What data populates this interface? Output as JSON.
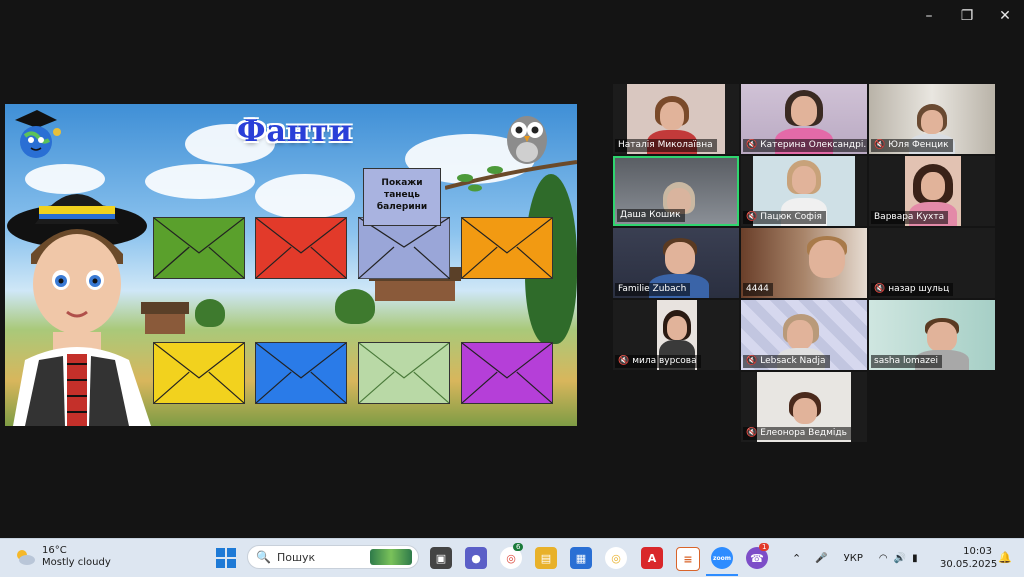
{
  "window": {
    "minimize_icon": "minimize-icon",
    "restore_icon": "restore-icon",
    "close_icon": "close-icon"
  },
  "slide": {
    "title": "Фанти",
    "card_text": "Покажи танець балерини",
    "envelope_colors": [
      "#5aa02c",
      "#e23a2a",
      "#9aa6d8",
      "#f29a12",
      "#f2d21e",
      "#2a7be8",
      "#b9d9a6",
      "#b53fd8"
    ]
  },
  "participants": [
    {
      "name": "Наталія Миколаївна",
      "muted": false
    },
    {
      "name": "Катерина Олександрі...",
      "muted": true
    },
    {
      "name": "Юля Фенцик",
      "muted": true
    },
    {
      "name": "Даша Кошик",
      "muted": false
    },
    {
      "name": "Пацюк Софія",
      "muted": true
    },
    {
      "name": "Варвара Кухта",
      "muted": false
    },
    {
      "name": "Familie Zubach",
      "muted": false
    },
    {
      "name": "4444",
      "muted": false
    },
    {
      "name": "назар шульц",
      "muted": true
    },
    {
      "name": "мила вурсова",
      "muted": true
    },
    {
      "name": "Lebsack Nadja",
      "muted": true
    },
    {
      "name": "sasha lomazei",
      "muted": false
    },
    {
      "name": "Елеонора Ведмідь",
      "muted": true
    }
  ],
  "taskbar": {
    "weather": {
      "temp": "16°C",
      "desc": "Mostly cloudy"
    },
    "search_placeholder": "Пошук",
    "chat_badge": "6",
    "viber_badge": "1",
    "language": "УКР",
    "time": "10:03",
    "date": "30.05.2025"
  }
}
